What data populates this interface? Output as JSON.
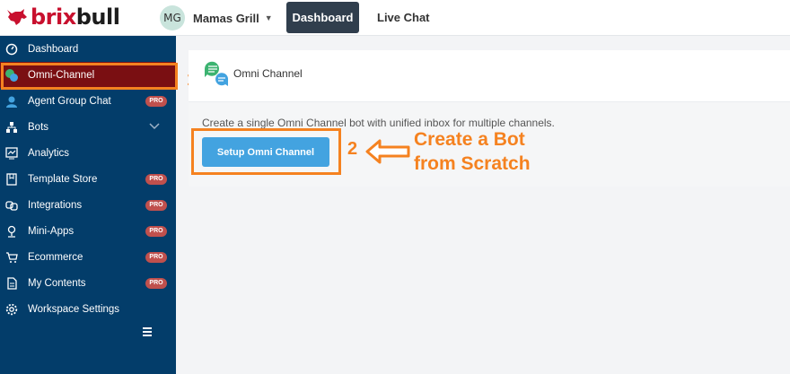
{
  "brand": {
    "name_red": "brix",
    "name_dark": "bull"
  },
  "header": {
    "workspace_initials": "MG",
    "workspace_name": "Mamas Grill",
    "nav_dashboard": "Dashboard",
    "nav_live_chat": "Live Chat"
  },
  "sidebar": {
    "items": [
      {
        "label": "Dashboard",
        "icon": "speedometer-icon"
      },
      {
        "label": "Omni-Channel",
        "icon": "omni-channel-icon",
        "active": true
      },
      {
        "label": "Agent Group Chat",
        "icon": "agent-icon",
        "badge": "PRO"
      },
      {
        "label": "Bots",
        "icon": "bots-icon",
        "chevron": true
      },
      {
        "label": "Analytics",
        "icon": "analytics-icon"
      },
      {
        "label": "Template Store",
        "icon": "template-icon",
        "badge": "PRO"
      },
      {
        "label": "Integrations",
        "icon": "integrations-icon",
        "badge": "PRO"
      },
      {
        "label": "Mini-Apps",
        "icon": "mini-apps-icon",
        "badge": "PRO"
      },
      {
        "label": "Ecommerce",
        "icon": "cart-icon",
        "badge": "PRO"
      },
      {
        "label": "My Contents",
        "icon": "document-icon",
        "badge": "PRO"
      },
      {
        "label": "Workspace Settings",
        "icon": "gear-icon"
      }
    ]
  },
  "main": {
    "card_title": "Omni Channel",
    "description": "Create a single Omni Channel bot with unified inbox for multiple channels.",
    "setup_button": "Setup Omni Channel"
  },
  "annotations": {
    "step1": "1",
    "step2": "2",
    "callout_line1": "Create a Bot",
    "callout_line2": "from Scratch"
  },
  "colors": {
    "sidebar_bg": "#033d6a",
    "active_item": "#7a0f12",
    "highlight": "#f58220",
    "setup_button": "#43a3e0",
    "pro_badge": "#c0504d"
  }
}
